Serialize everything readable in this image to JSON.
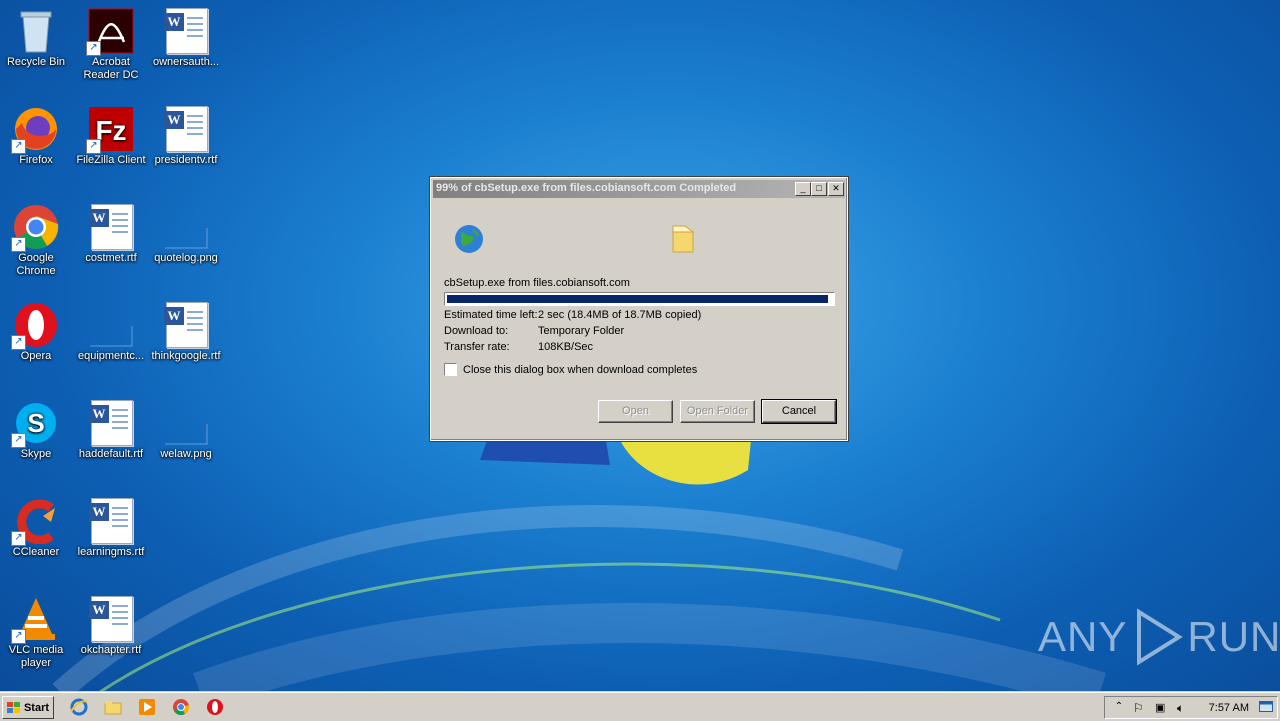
{
  "desktop": {
    "icons": [
      {
        "label": "Recycle Bin",
        "icon": "recycle-bin-icon"
      },
      {
        "label": "Acrobat Reader DC",
        "icon": "acrobat-icon"
      },
      {
        "label": "ownersauth...",
        "icon": "word-document-icon"
      },
      {
        "label": "Firefox",
        "icon": "firefox-icon"
      },
      {
        "label": "FileZilla Client",
        "icon": "filezilla-icon"
      },
      {
        "label": "presidentv.rtf",
        "icon": "word-document-icon"
      },
      {
        "label": "Google Chrome",
        "icon": "chrome-icon"
      },
      {
        "label": "costmet.rtf",
        "icon": "word-document-icon"
      },
      {
        "label": "quotelog.png",
        "icon": "image-file-icon"
      },
      {
        "label": "Opera",
        "icon": "opera-icon"
      },
      {
        "label": "equipmentc...",
        "icon": "image-file-icon"
      },
      {
        "label": "thinkgoogle.rtf",
        "icon": "word-document-icon"
      },
      {
        "label": "Skype",
        "icon": "skype-icon"
      },
      {
        "label": "haddefault.rtf",
        "icon": "word-document-icon"
      },
      {
        "label": "welaw.png",
        "icon": "image-file-icon"
      },
      {
        "label": "CCleaner",
        "icon": "ccleaner-icon"
      },
      {
        "label": "learningms.rtf",
        "icon": "word-document-icon"
      },
      {
        "label": "VLC media player",
        "icon": "vlc-icon"
      },
      {
        "label": "okchapter.rtf",
        "icon": "word-document-icon"
      }
    ]
  },
  "dialog": {
    "title": "99% of cbSetup.exe from files.cobiansoft.com Completed",
    "source": "cbSetup.exe from files.cobiansoft.com",
    "progress": 0.99,
    "info": [
      {
        "key": "Estimated time left:",
        "value": "2 sec (18.4MB of 18.7MB copied)"
      },
      {
        "key": "Download to:",
        "value": "Temporary Folder"
      },
      {
        "key": "Transfer rate:",
        "value": "108KB/Sec"
      }
    ],
    "checkbox_label": "Close this dialog box when download completes",
    "buttons": {
      "open": "Open",
      "open_folder": "Open Folder",
      "cancel": "Cancel"
    }
  },
  "taskbar": {
    "start_label": "Start",
    "clock": "7:57 AM"
  },
  "watermark": {
    "left": "ANY",
    "right": "RUN"
  }
}
